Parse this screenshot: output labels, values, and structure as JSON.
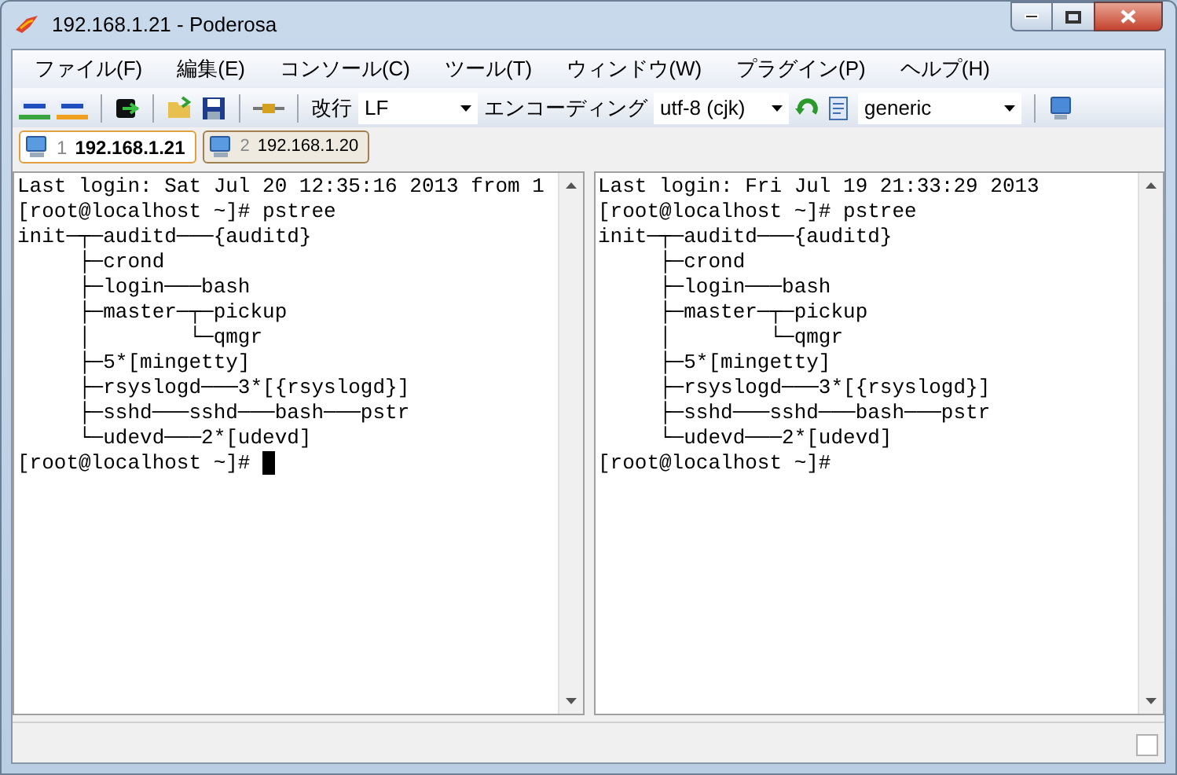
{
  "window": {
    "title": "192.168.1.21 - Poderosa"
  },
  "menu": [
    "ファイル(F)",
    "編集(E)",
    "コンソール(C)",
    "ツール(T)",
    "ウィンドウ(W)",
    "プラグイン(P)",
    "ヘルプ(H)"
  ],
  "toolbar": {
    "newline_label": "改行",
    "newline_value": "LF",
    "encoding_label": "エンコーディング",
    "encoding_value": "utf-8 (cjk)",
    "terminal_type": "generic"
  },
  "tabs": [
    {
      "number": "1",
      "label": "192.168.1.21",
      "selected": true
    },
    {
      "number": "2",
      "label": "192.168.1.20",
      "selected": false
    }
  ],
  "panes": [
    {
      "cursor": true,
      "lines": [
        "Last login: Sat Jul 20 12:35:16 2013 from 1",
        "[root@localhost ~]# pstree",
        "init─┬─auditd───{auditd}",
        "     ├─crond",
        "     ├─login───bash",
        "     ├─master─┬─pickup",
        "     │        └─qmgr",
        "     ├─5*[mingetty]",
        "     ├─rsyslogd───3*[{rsyslogd}]",
        "     ├─sshd───sshd───bash───pstr",
        "     └─udevd───2*[udevd]",
        "[root@localhost ~]# "
      ]
    },
    {
      "cursor": false,
      "lines": [
        "Last login: Fri Jul 19 21:33:29 2013",
        "[root@localhost ~]# pstree",
        "init─┬─auditd───{auditd}",
        "     ├─crond",
        "     ├─login───bash",
        "     ├─master─┬─pickup",
        "     │        └─qmgr",
        "     ├─5*[mingetty]",
        "     ├─rsyslogd───3*[{rsyslogd}]",
        "     ├─sshd───sshd───bash───pstr",
        "     └─udevd───2*[udevd]",
        "[root@localhost ~]# "
      ]
    }
  ]
}
